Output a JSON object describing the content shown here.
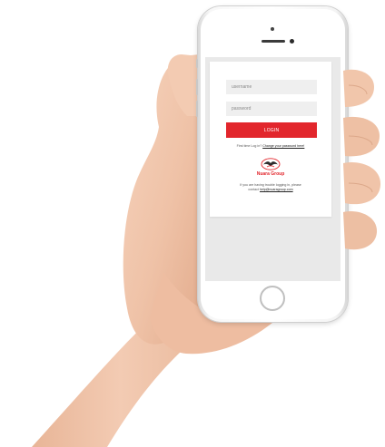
{
  "login": {
    "username_placeholder": "username",
    "password_placeholder": "password",
    "login_label": "LOGIN",
    "first_time_text": "First time Log in?",
    "change_password_link": "Change your password here!",
    "brand_name": "Nuara Group",
    "help_line1": "If you are having trouble logging in, please",
    "help_line2_prefix": "contact",
    "help_email": "help@nuaragroup.com"
  },
  "colors": {
    "accent": "#e2262c",
    "skin": "#f2c9b0"
  },
  "icons": {
    "brand_logo": "nuara-wing-logo-icon"
  }
}
